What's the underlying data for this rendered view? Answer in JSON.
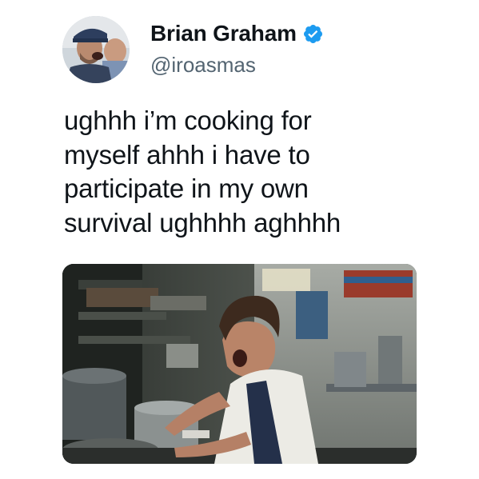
{
  "tweet": {
    "author": {
      "display_name": "Brian Graham",
      "handle": "@iroasmas",
      "verified": true,
      "verified_icon": "verified-badge-icon",
      "verified_color": "#1d9bf0"
    },
    "text_lines": [
      "ughhh i’m cooking for",
      "myself ahhh i have to",
      "participate in my own",
      "survival ughhhh aghhhh"
    ],
    "media": {
      "type": "photo"
    }
  }
}
